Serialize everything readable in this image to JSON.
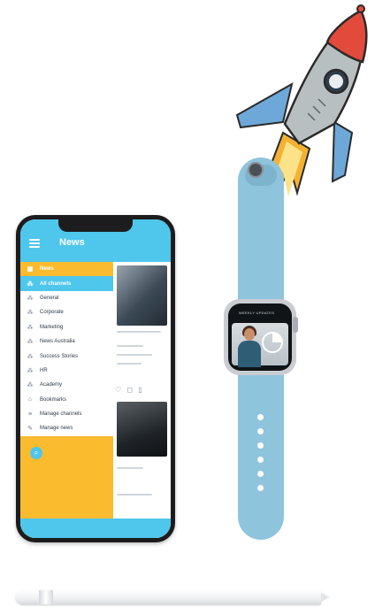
{
  "phone": {
    "app": {
      "title": "News",
      "menu_items": [
        {
          "label": "News",
          "icon": "grid-icon",
          "state": "header"
        },
        {
          "label": "All channels",
          "icon": "channels-icon",
          "state": "active"
        },
        {
          "label": "General",
          "icon": "channel-icon",
          "state": "normal"
        },
        {
          "label": "Corporate",
          "icon": "channel-icon",
          "state": "normal"
        },
        {
          "label": "Marketing",
          "icon": "channel-icon",
          "state": "normal"
        },
        {
          "label": "News Australia",
          "icon": "channel-icon",
          "state": "normal"
        },
        {
          "label": "Success Stories",
          "icon": "channel-icon",
          "state": "normal"
        },
        {
          "label": "HR",
          "icon": "channel-icon",
          "state": "normal"
        },
        {
          "label": "Academy",
          "icon": "channel-icon",
          "state": "normal"
        },
        {
          "label": "Bookmarks",
          "icon": "tag-icon",
          "state": "normal"
        },
        {
          "label": "Manage channels",
          "icon": "list-icon",
          "state": "normal"
        },
        {
          "label": "Manage news",
          "icon": "pencil-icon",
          "state": "normal"
        }
      ],
      "fab_icon": "search-icon"
    }
  },
  "watch": {
    "title": "WEEKLY UPDATES"
  },
  "colors": {
    "accent_blue": "#4fc6ec",
    "accent_yellow": "#fbbb2e",
    "band_blue": "#8fc4dd"
  }
}
